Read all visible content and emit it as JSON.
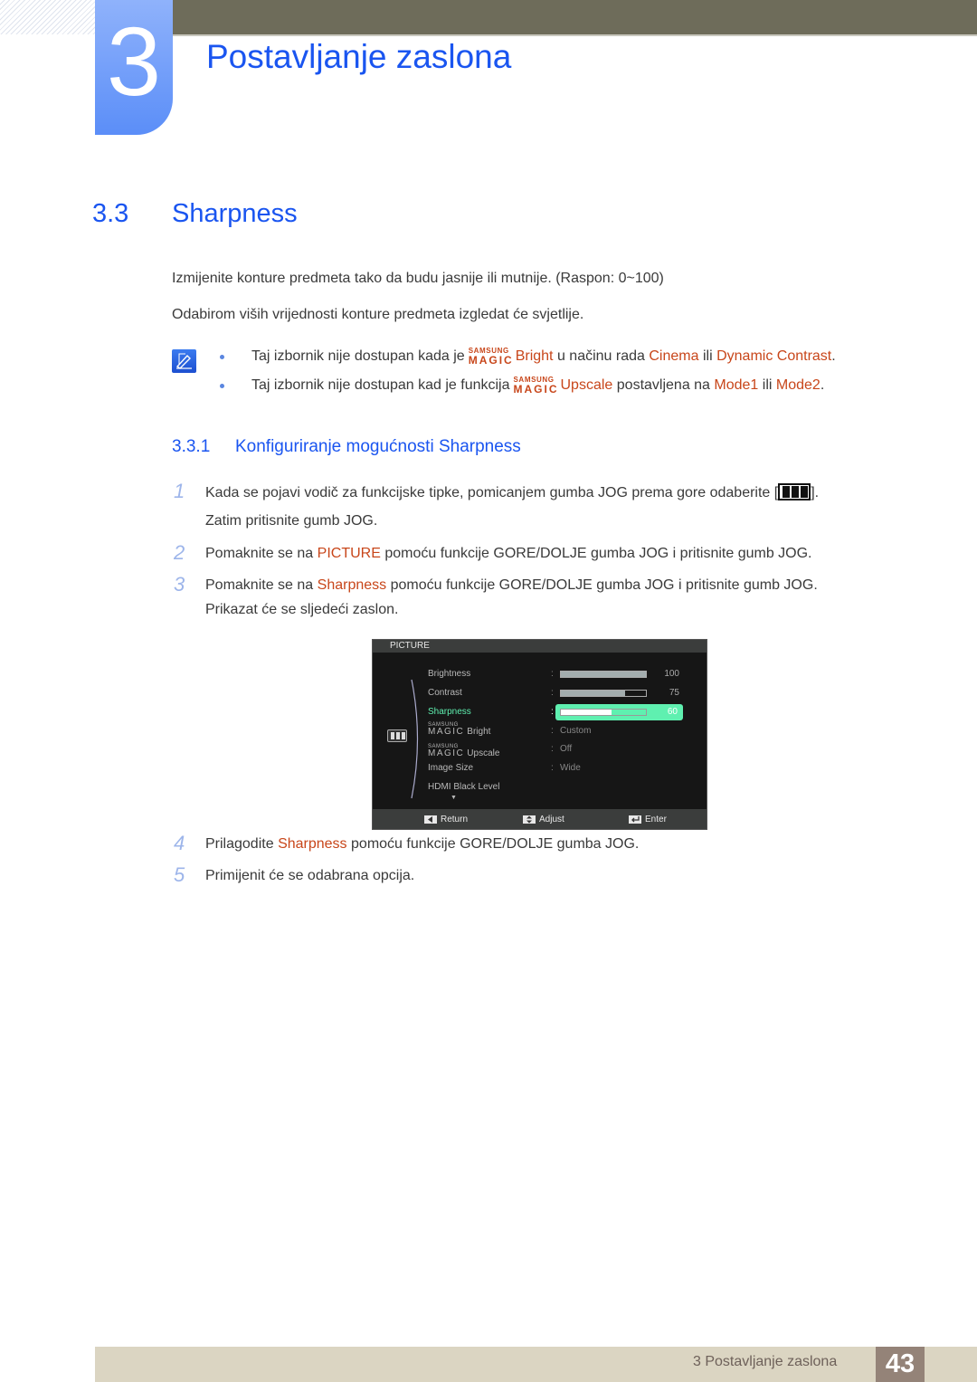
{
  "header": {
    "chapter_number": "3",
    "chapter_title": "Postavljanje zaslona"
  },
  "section": {
    "number": "3.3",
    "title": "Sharpness",
    "paragraphs": [
      "Izmijenite konture predmeta tako da budu jasnije ili mutnije. (Raspon: 0~100)",
      "Odabirom viših vrijednosti konture predmeta izgledat će svjetlije."
    ]
  },
  "notes": [
    {
      "before": "Taj izbornik nije dostupan kada je",
      "magic_top": "SAMSUNG",
      "magic_bottom": "MAGIC",
      "feature": "Bright",
      "middle": "u načinu rada",
      "opt1": "Cinema",
      "or": "ili",
      "opt2": "Dynamic Contrast",
      "end": "."
    },
    {
      "before": "Taj izbornik nije dostupan kad je funkcija",
      "magic_top": "SAMSUNG",
      "magic_bottom": "MAGIC",
      "feature": "Upscale",
      "middle": "postavljena na",
      "opt1": "Mode1",
      "or": "ili",
      "opt2": "Mode2",
      "end": "."
    }
  ],
  "subsection": {
    "number": "3.3.1",
    "title": "Konfiguriranje mogućnosti Sharpness"
  },
  "steps": [
    {
      "num": "1",
      "line1_before": "Kada se pojavi vodič za funkcijske tipke, pomicanjem gumba JOG prema gore odaberite [",
      "line1_after": "].",
      "line2": "Zatim pritisnite gumb JOG."
    },
    {
      "num": "2",
      "before": "Pomaknite se na",
      "hl": "PICTURE",
      "after": "pomoću funkcije GORE/DOLJE gumba JOG i pritisnite gumb JOG."
    },
    {
      "num": "3",
      "before": "Pomaknite se na",
      "hl": "Sharpness",
      "after": "pomoću funkcije GORE/DOLJE gumba JOG i pritisnite gumb JOG.",
      "line2": "Prikazat će se sljedeći zaslon."
    },
    {
      "num": "4",
      "before": "Prilagodite",
      "hl": "Sharpness",
      "after": "pomoću funkcije GORE/DOLJE gumba JOG."
    },
    {
      "num": "5",
      "text": "Primijenit će se odabrana opcija."
    }
  ],
  "osd": {
    "title": "PICTURE",
    "items": [
      {
        "label": "Brightness",
        "value": 100,
        "type": "bar"
      },
      {
        "label": "Contrast",
        "value": 75,
        "type": "bar"
      },
      {
        "label": "Sharpness",
        "value": 60,
        "type": "bar",
        "selected": true
      },
      {
        "label": "Bright",
        "magic": true,
        "value": "Custom"
      },
      {
        "label": "Upscale",
        "magic": true,
        "value": "Off"
      },
      {
        "label": "Image Size",
        "value": "Wide"
      },
      {
        "label": "HDMI Black Level",
        "value": ""
      }
    ],
    "magic_top": "SAMSUNG",
    "magic_bottom": "MAGIC",
    "colon": ":",
    "more_arrow": "▼",
    "footer": {
      "return": "Return",
      "adjust": "Adjust",
      "enter": "Enter"
    },
    "colors": {
      "selected": "#5ff0b0",
      "bar_fill": "#a3adae"
    }
  },
  "footer": {
    "label": "3 Postavljanje zaslona",
    "page": "43"
  },
  "colors": {
    "heading_blue": "#1a55f0",
    "highlight_orange": "#c8461a"
  }
}
